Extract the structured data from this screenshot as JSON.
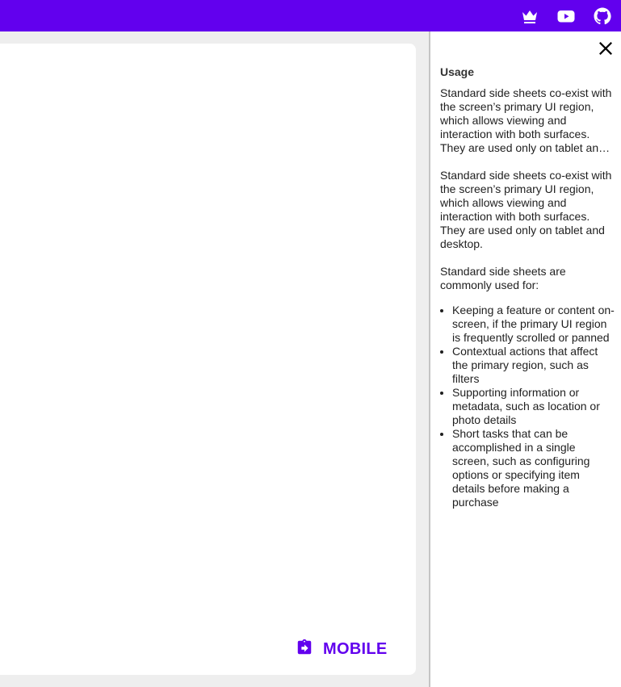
{
  "colors": {
    "primary": "#6200ee",
    "on_primary": "#ffffff",
    "surface": "#ffffff",
    "background": "#eeeeee"
  },
  "topbar": {
    "icons": [
      "crown-icon",
      "youtube-icon",
      "github-icon"
    ]
  },
  "main": {
    "mobile_button_label": "MOBILE",
    "mobile_button_icon": "clipboard-arrow-icon"
  },
  "side_sheet": {
    "close_icon": "close-icon",
    "title": "Usage",
    "paragraph_truncated": "Standard side sheets co-exist with the screen’s primary UI region, which allows viewing and interaction with both surfaces. They are used only on tablet and desktop.",
    "paragraph_full": "Standard side sheets co-exist with the screen’s primary UI region, which allows viewing and interaction with both surfaces. They are used only on tablet and desktop.",
    "list_intro": "Standard side sheets are commonly used for:",
    "list_items": [
      "Keeping a feature or content on-screen, if the primary UI region is frequently scrolled or panned",
      "Contextual actions that affect the primary region, such as filters",
      "Supporting information or metadata, such as location or photo details",
      "Short tasks that can be accomplished in a single screen, such as configuring options or specifying item details before making a purchase"
    ]
  }
}
